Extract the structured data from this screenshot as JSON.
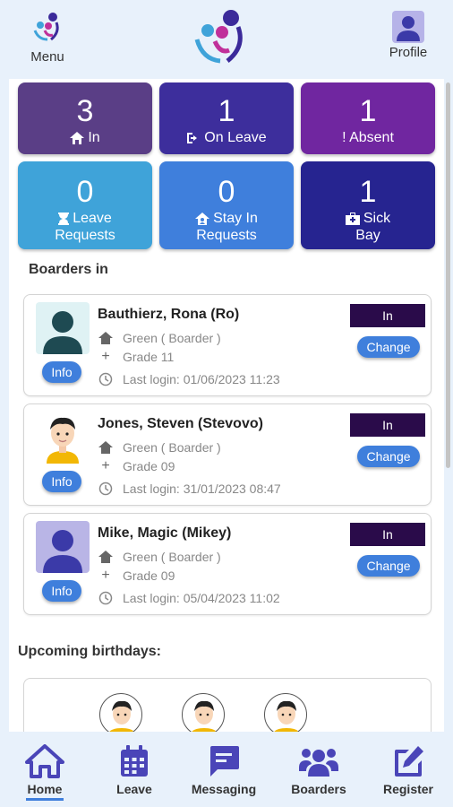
{
  "header": {
    "menu_label": "Menu",
    "profile_label": "Profile"
  },
  "tiles": [
    {
      "count": "3",
      "label": "In",
      "color": "#5a3e86"
    },
    {
      "count": "1",
      "label": "On Leave",
      "color": "#3d2e9c"
    },
    {
      "count": "1",
      "label": "! Absent",
      "color": "#7026a0"
    },
    {
      "count": "0",
      "label_1": "Leave",
      "label_2": "Requests",
      "color": "#3fa3d9"
    },
    {
      "count": "0",
      "label_1": "Stay In",
      "label_2": "Requests",
      "color": "#3f7fdc"
    },
    {
      "count": "1",
      "label_1": "Sick",
      "label_2": "Bay",
      "color": "#262490"
    }
  ],
  "boarders_title": "Boarders in",
  "boarders": [
    {
      "name": "Bauthierz, Rona (Ro)",
      "house": "Green ( Boarder )",
      "grade": "Grade 11",
      "last_login": "Last login: 01/06/2023 11:23",
      "status": "In",
      "change_label": "Change",
      "info_label": "Info",
      "avatar": "silhouette-teal"
    },
    {
      "name": "Jones, Steven (Stevovo)",
      "house": "Green ( Boarder )",
      "grade": "Grade 09",
      "last_login": "Last login: 31/01/2023 08:47",
      "status": "In",
      "change_label": "Change",
      "info_label": "Info",
      "avatar": "cartoon-boy"
    },
    {
      "name": "Mike, Magic (Mikey)",
      "house": "Green ( Boarder )",
      "grade": "Grade 09",
      "last_login": "Last login: 05/04/2023 11:02",
      "status": "In",
      "change_label": "Change",
      "info_label": "Info",
      "avatar": "silhouette-purple"
    }
  ],
  "birthdays_title": "Upcoming birthdays:",
  "nav": [
    {
      "label": "Home",
      "icon": "home-icon",
      "active": true
    },
    {
      "label": "Leave",
      "icon": "calendar-icon"
    },
    {
      "label": "Messaging",
      "icon": "message-icon"
    },
    {
      "label": "Boarders",
      "icon": "people-icon"
    },
    {
      "label": "Register",
      "icon": "edit-icon"
    }
  ],
  "colors": {
    "accent": "#3f7fdc",
    "nav_icon": "#4a45b8",
    "status_bg": "#2a0b4a",
    "background": "#e8f1fb"
  }
}
